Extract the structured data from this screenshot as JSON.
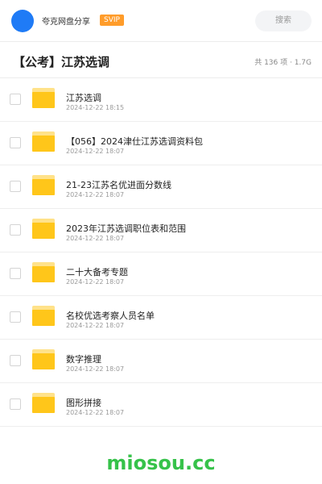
{
  "header": {
    "share_title": "夸克网盘分享",
    "badge": "SVIP",
    "search_placeholder": "搜索"
  },
  "folder": {
    "title": "【公考】江苏选调",
    "meta": "共 136 项 · 1.7G"
  },
  "items": [
    {
      "name": "江苏选调",
      "date": "2024-12-22 18:15"
    },
    {
      "name": "【056】2024津仕江苏选调资料包",
      "date": "2024-12-22 18:07"
    },
    {
      "name": "21-23江苏名优进面分数线",
      "date": "2024-12-22 18:07"
    },
    {
      "name": "2023年江苏选调职位表和范围",
      "date": "2024-12-22 18:07"
    },
    {
      "name": "二十大备考专题",
      "date": "2024-12-22 18:07"
    },
    {
      "name": "名校优选考察人员名单",
      "date": "2024-12-22 18:07"
    },
    {
      "name": "数字推理",
      "date": "2024-12-22 18:07"
    },
    {
      "name": "图形拼接",
      "date": "2024-12-22 18:07"
    }
  ],
  "watermark": "miosou.cc",
  "colors": {
    "avatar": "#1f7bf6",
    "svip_badge": "#ff9c2a",
    "folder_icon": "#ffc61a",
    "watermark": "#36c24a"
  }
}
